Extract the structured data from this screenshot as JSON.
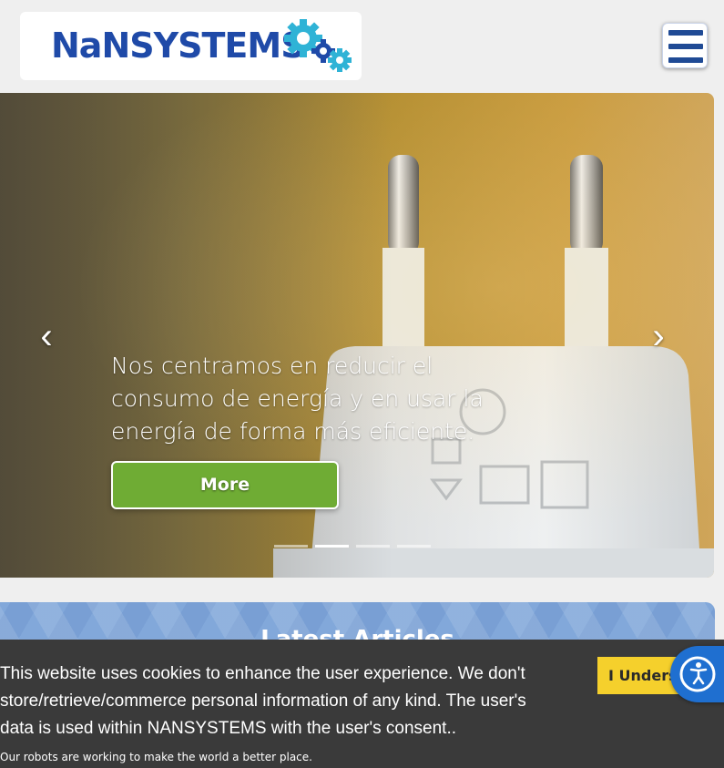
{
  "header": {
    "logo_text": "NaNSYSTEMS",
    "menu_icon": "hamburger-icon"
  },
  "hero": {
    "caption": "Nos centramos en reducir el consumo de energía y en usar la energía de forma más eficiente.",
    "more_label": "More",
    "prev_glyph": "‹",
    "next_glyph": "›",
    "slide_count": 4,
    "active_slide": 2
  },
  "articles": {
    "title": "Latest Articles"
  },
  "cookie": {
    "message": "This website uses cookies to enhance the user experience. We don't store/retrieve/commerce personal information of any kind. The user's data is used within NANSYSTEMS with the user's consent..",
    "tagline": "Our robots are working to make the world a better place.",
    "button_label": "I Understand"
  },
  "accessibility": {
    "icon": "accessibility-icon"
  },
  "colors": {
    "brand_blue": "#1f4aa8",
    "gear_cyan": "#2fb3d6",
    "button_green": "#6fac34",
    "cookie_bg": "#3a3a3a",
    "cookie_button": "#f5d02c",
    "accessibility_blue": "#1f6fd0"
  }
}
